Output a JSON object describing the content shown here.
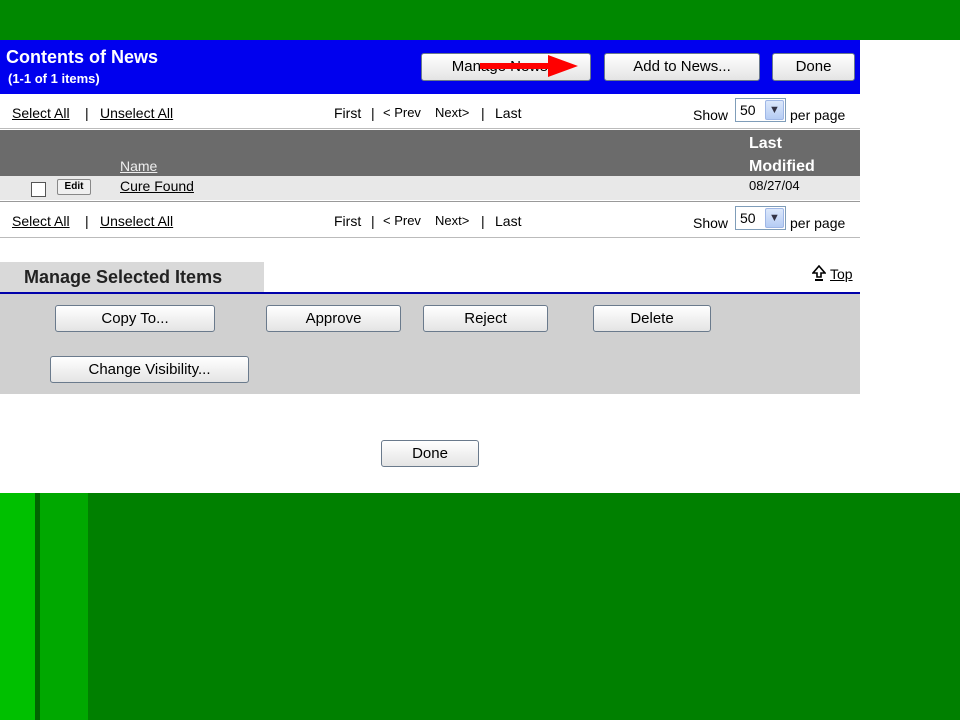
{
  "header": {
    "title": "Contents of News",
    "count": "(1-1 of 1 items)",
    "buttons": {
      "manage_news": "Manage News...",
      "add_to_news": "Add to News...",
      "done": "Done"
    },
    "arrow_color": "#ff0000"
  },
  "pager": {
    "select_all": "Select All",
    "separator": "|",
    "unselect_all": "Unselect All",
    "first": "First",
    "prev": "< Prev",
    "next": "Next>",
    "last": "Last",
    "show": "Show",
    "per_page_value": "50",
    "per_page": "per page"
  },
  "table": {
    "columns": {
      "name": "Name",
      "last_modified": "Last Modified"
    },
    "rows": [
      {
        "action": "Edit",
        "name": "Cure Found",
        "date": "08/27/04"
      }
    ]
  },
  "manage": {
    "title": "Manage Selected Items",
    "top_link": "Top",
    "buttons": {
      "copy_to": "Copy To...",
      "approve": "Approve",
      "reject": "Reject",
      "delete": "Delete",
      "change_visibility": "Change Visibility..."
    }
  },
  "footer": {
    "done": "Done"
  },
  "colors": {
    "header_bg": "#0000ee",
    "table_head_bg": "#6b6b6b",
    "slide_green": "#008000"
  }
}
